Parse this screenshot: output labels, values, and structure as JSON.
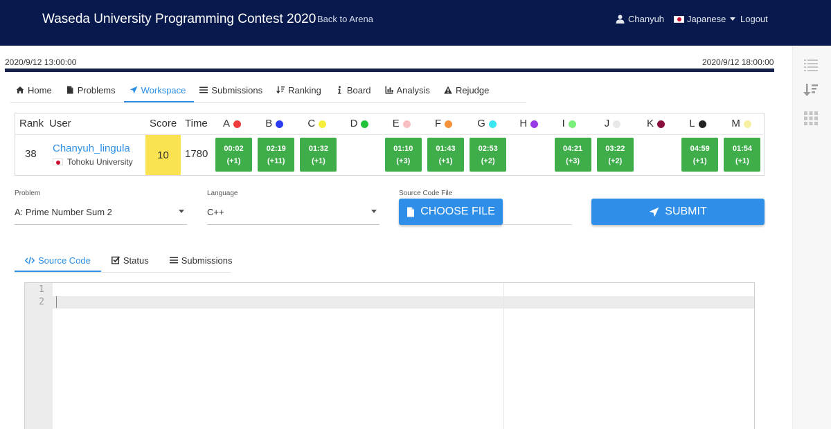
{
  "header": {
    "title": "Waseda University Programming Contest 2020",
    "back_link": "Back to Arena",
    "user": "Chanyuh",
    "language": "Japanese",
    "logout": "Logout"
  },
  "timeline": {
    "start": "2020/9/12 13:00:00",
    "end": "2020/9/12 18:00:00",
    "progress": 1.0
  },
  "nav": {
    "tabs": [
      {
        "label": "Home",
        "icon": "home-icon"
      },
      {
        "label": "Problems",
        "icon": "file-icon"
      },
      {
        "label": "Workspace",
        "icon": "paper-plane-icon",
        "active": true
      },
      {
        "label": "Submissions",
        "icon": "list-icon"
      },
      {
        "label": "Ranking",
        "icon": "sort-icon"
      },
      {
        "label": "Board",
        "icon": "info-icon"
      },
      {
        "label": "Analysis",
        "icon": "bar-chart-icon"
      },
      {
        "label": "Rejudge",
        "icon": "warning-icon"
      }
    ]
  },
  "standings": {
    "headers": {
      "rank": "Rank",
      "user": "User",
      "score": "Score",
      "time": "Time"
    },
    "problems": [
      {
        "letter": "A",
        "color": "#f03c3c"
      },
      {
        "letter": "B",
        "color": "#2d3ef0"
      },
      {
        "letter": "C",
        "color": "#f5ee3c"
      },
      {
        "letter": "D",
        "color": "#22c23a"
      },
      {
        "letter": "E",
        "color": "#f7bfbf"
      },
      {
        "letter": "F",
        "color": "#f5923a"
      },
      {
        "letter": "G",
        "color": "#3ae6f0"
      },
      {
        "letter": "H",
        "color": "#9a3ae6"
      },
      {
        "letter": "I",
        "color": "#7af07a"
      },
      {
        "letter": "J",
        "color": "#e8e8e8"
      },
      {
        "letter": "K",
        "color": "#8a0f3f"
      },
      {
        "letter": "L",
        "color": "#222222"
      },
      {
        "letter": "M",
        "color": "#f7f0a0"
      }
    ],
    "row": {
      "rank": "38",
      "user": "Chanyuh_lingula",
      "affiliation": "Tohoku University",
      "score": "10",
      "time": "1780",
      "cells": [
        {
          "time": "00:02",
          "penalty": "(+1)"
        },
        {
          "time": "02:19",
          "penalty": "(+11)"
        },
        {
          "time": "01:32",
          "penalty": "(+1)"
        },
        null,
        {
          "time": "01:10",
          "penalty": "(+3)"
        },
        {
          "time": "01:43",
          "penalty": "(+1)"
        },
        {
          "time": "02:53",
          "penalty": "(+2)"
        },
        null,
        {
          "time": "04:21",
          "penalty": "(+3)"
        },
        {
          "time": "03:22",
          "penalty": "(+2)"
        },
        null,
        {
          "time": "04:59",
          "penalty": "(+1)"
        },
        {
          "time": "01:54",
          "penalty": "(+1)"
        }
      ]
    }
  },
  "form": {
    "problem_label": "Problem",
    "problem_value": "A: Prime Number Sum 2",
    "language_label": "Language",
    "language_value": "C++",
    "file_label": "Source Code File",
    "choose_file": "CHOOSE FILE",
    "submit": "SUBMIT"
  },
  "subtabs": [
    {
      "label": "Source Code",
      "icon": "code-icon",
      "active": true
    },
    {
      "label": "Status",
      "icon": "check-square-icon"
    },
    {
      "label": "Submissions",
      "icon": "list-icon"
    }
  ],
  "editor": {
    "line_numbers": [
      "1",
      "2"
    ]
  },
  "colors": {
    "header_bg": "#081a4d",
    "accent": "#2e8ee8",
    "accepted": "#3fae4a",
    "score_highlight": "#fbe250"
  }
}
